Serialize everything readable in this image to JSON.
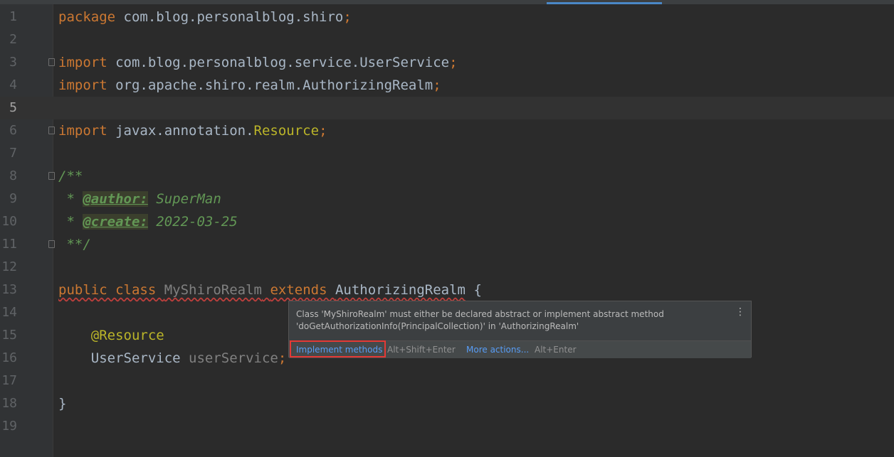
{
  "editor": {
    "lines": [
      {
        "n": "1",
        "tokens": [
          {
            "t": "package ",
            "c": "kw"
          },
          {
            "t": "com.blog.personalblog.shiro",
            "c": "pl"
          },
          {
            "t": ";",
            "c": "kw"
          }
        ]
      },
      {
        "n": "2",
        "tokens": []
      },
      {
        "n": "3",
        "fold": true,
        "tokens": [
          {
            "t": "import ",
            "c": "kw"
          },
          {
            "t": "com.blog.personalblog.service.UserService",
            "c": "pl"
          },
          {
            "t": ";",
            "c": "kw"
          }
        ]
      },
      {
        "n": "4",
        "tokens": [
          {
            "t": "import ",
            "c": "kw"
          },
          {
            "t": "org.apache.shiro.realm.AuthorizingRealm",
            "c": "pl"
          },
          {
            "t": ";",
            "c": "kw"
          }
        ]
      },
      {
        "n": "5",
        "current": true,
        "tokens": []
      },
      {
        "n": "6",
        "fold": true,
        "tokens": [
          {
            "t": "import ",
            "c": "kw"
          },
          {
            "t": "javax.annotation.",
            "c": "pl"
          },
          {
            "t": "Resource",
            "c": "yel"
          },
          {
            "t": ";",
            "c": "kw"
          }
        ]
      },
      {
        "n": "7",
        "tokens": []
      },
      {
        "n": "8",
        "fold": true,
        "tokens": [
          {
            "t": "/**",
            "c": "doc"
          }
        ]
      },
      {
        "n": "9",
        "tokens": [
          {
            "t": " * ",
            "c": "doc"
          },
          {
            "t": "@author:",
            "c": "tag"
          },
          {
            "t": " SuperMan",
            "c": "doc"
          }
        ]
      },
      {
        "n": "10",
        "tokens": [
          {
            "t": " * ",
            "c": "doc"
          },
          {
            "t": "@create:",
            "c": "tag"
          },
          {
            "t": " 2022-03-25",
            "c": "doc"
          }
        ]
      },
      {
        "n": "11",
        "fold": true,
        "tokens": [
          {
            "t": " **/",
            "c": "doc"
          }
        ]
      },
      {
        "n": "12",
        "tokens": []
      },
      {
        "n": "13",
        "tokens": [
          {
            "t": "public class ",
            "c": "kw squig"
          },
          {
            "t": "MyShiroRealm",
            "c": "gray squig"
          },
          {
            "t": " ",
            "c": "pl squig"
          },
          {
            "t": "extends ",
            "c": "kw squig"
          },
          {
            "t": "AuthorizingRealm",
            "c": "pl squig"
          },
          {
            "t": " {",
            "c": "pl"
          }
        ]
      },
      {
        "n": "14",
        "tokens": []
      },
      {
        "n": "15",
        "tokens": [
          {
            "t": "    ",
            "c": "pl"
          },
          {
            "t": "@Resource",
            "c": "ann"
          }
        ]
      },
      {
        "n": "16",
        "tokens": [
          {
            "t": "    ",
            "c": "pl"
          },
          {
            "t": "UserService ",
            "c": "pl"
          },
          {
            "t": "userService",
            "c": "gray"
          },
          {
            "t": ";",
            "c": "kw"
          }
        ]
      },
      {
        "n": "17",
        "tokens": []
      },
      {
        "n": "18",
        "tokens": [
          {
            "t": "}",
            "c": "pl"
          }
        ]
      },
      {
        "n": "19",
        "tokens": []
      }
    ]
  },
  "popup": {
    "message": "Class 'MyShiroRealm' must either be declared abstract or implement abstract method\n'doGetAuthorizationInfo(PrincipalCollection)' in 'AuthorizingRealm'",
    "more_icon": "⋮",
    "implement_label": "Implement methods",
    "implement_shortcut": "Alt+Shift+Enter",
    "more_actions_label": "More actions...",
    "more_actions_shortcut": "Alt+Enter"
  }
}
